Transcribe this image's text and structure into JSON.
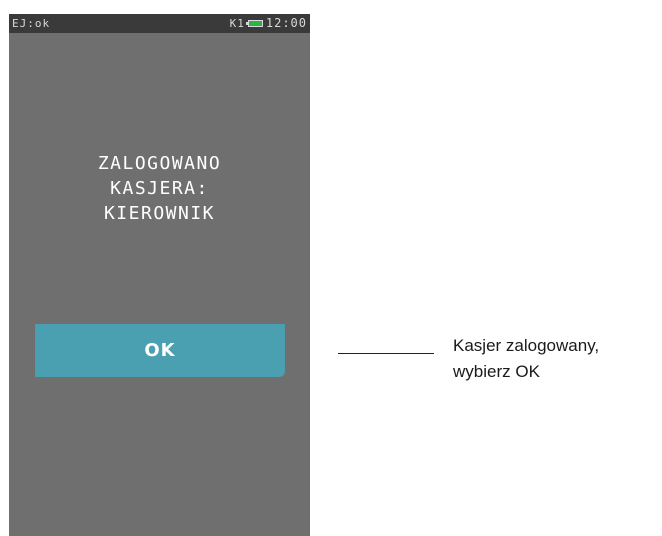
{
  "status_bar": {
    "left_text": "EJ:ok",
    "keyboard_indicator": "K1",
    "battery_icon": "battery-icon",
    "time": "12:00"
  },
  "message": {
    "line1": "ZALOGOWANO",
    "line2": "KASJERA:",
    "line3": "KIEROWNIK"
  },
  "ok_button": {
    "label": "OK"
  },
  "callout": {
    "line1": "Kasjer zalogowany,",
    "line2": "wybierz OK"
  },
  "colors": {
    "screen_bg": "#6f6f6f",
    "status_bar_bg": "#3a3a3a",
    "button_bg": "#4a9fb0",
    "battery_fill": "#2fb14a"
  }
}
